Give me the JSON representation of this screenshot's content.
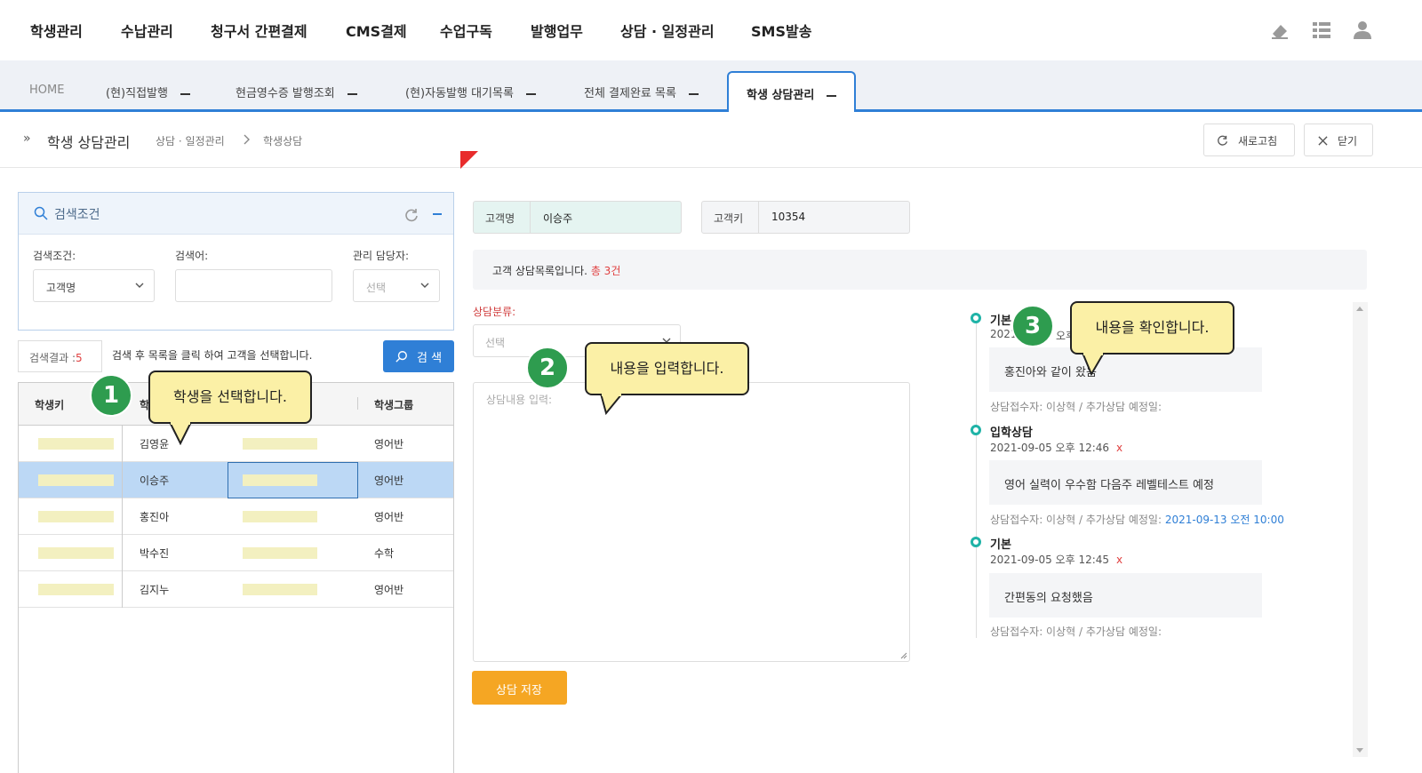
{
  "nav": {
    "menus": [
      "학생관리",
      "수납관리",
      "청구서 간편결제",
      "CMS결제",
      "수업구독",
      "발행업무",
      "상담 · 일정관리",
      "SMS발송"
    ],
    "icons": [
      "eraser-icon",
      "list-icon",
      "user-icon"
    ]
  },
  "tabs": {
    "home": "HOME",
    "items": [
      "(현)직접발행",
      "현금영수증 발행조회",
      "(현)자동발행 대기목록",
      "전체 결제완료 목록"
    ],
    "active": "학생 상담관리"
  },
  "header": {
    "title": "학생 상담관리",
    "breadcrumb": [
      "상담 · 일정관리",
      "학생상담"
    ],
    "refresh_label": "새로고침",
    "close_label": "닫기"
  },
  "search": {
    "title": "검색조건",
    "condition_label": "검색조건:",
    "condition_value": "고객명",
    "keyword_label": "검색어:",
    "keyword_value": "",
    "manager_label": "관리 담당자:",
    "manager_placeholder": "선택",
    "result_label": "검색결과 :",
    "result_count": "5",
    "hint": "검색 후 목록을 클릭 하여 고객을 선택합니다.",
    "button_label": "검 색"
  },
  "grid": {
    "headers": [
      "학생키",
      "학",
      "학생그룹"
    ],
    "rows": [
      {
        "name": "김영윤",
        "group": "영어반"
      },
      {
        "name": "이승주",
        "group": "영어반"
      },
      {
        "name": "홍진아",
        "group": "영어반"
      },
      {
        "name": "박수진",
        "group": "수학"
      },
      {
        "name": "김지누",
        "group": "영어반"
      }
    ],
    "selected_index": 1
  },
  "customer": {
    "name_label": "고객명",
    "name_value": "이승주",
    "key_label": "고객키",
    "key_value": "10354"
  },
  "info": {
    "text": "고객 상담목록입니다.",
    "count": "총 3건"
  },
  "form": {
    "category_label": "상담분류:",
    "category_placeholder": "선택",
    "content_placeholder": "상담내용 입력:",
    "save_label": "상담 저장"
  },
  "timeline": [
    {
      "type": "기본",
      "date": "2021-09-05 오후 12:4?",
      "date_visible": "2021",
      "date_tail": "오후",
      "content": "홍진아와 같이 왔음",
      "foot": "상담접수자: 이상혁 / 추가상담 예정일:",
      "next": ""
    },
    {
      "type": "입학상담",
      "date": "2021-09-05 오후 12:46",
      "content": "영어 실력이 우수함 다음주 레벨테스트 예정",
      "foot": "상담접수자: 이상혁 / 추가상담 예정일:",
      "next": "2021-09-13 오전 10:00"
    },
    {
      "type": "기본",
      "date": "2021-09-05 오후 12:45",
      "content": "간편동의 요청했음",
      "foot": "상담접수자: 이상혁 / 추가상담 예정일:",
      "next": ""
    }
  ],
  "timeline_delete": "x",
  "callouts": [
    {
      "num": "1",
      "text": "학생을 선택합니다."
    },
    {
      "num": "2",
      "text": "내용을 입력합니다."
    },
    {
      "num": "3",
      "text": "내용을 확인합니다."
    }
  ],
  "colors": {
    "accent": "#2f7fd6",
    "save": "#f5a623",
    "badge": "#2e9c4f",
    "bubble": "#fbf0a6",
    "selected_row": "#bcd8f5",
    "mask": "#f3f0c0",
    "timeline_dot": "#1fb3a7"
  }
}
